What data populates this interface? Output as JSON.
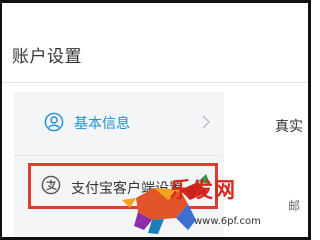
{
  "page": {
    "title": "账户设置"
  },
  "sidebar": {
    "items": [
      {
        "label": "基本信息",
        "icon": "user-circle-icon",
        "color": "#1d8fd8"
      },
      {
        "label": "支付宝客户端设置",
        "icon": "alipay-icon",
        "highlight_color": "#e03c31"
      }
    ]
  },
  "content": {
    "partial_label_1": "真实",
    "partial_label_2": "邮"
  },
  "watermark": {
    "title": "乐发网",
    "url": "www.6pf.com"
  }
}
